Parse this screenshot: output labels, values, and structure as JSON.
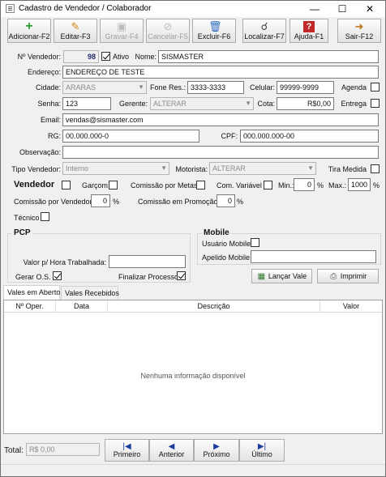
{
  "window": {
    "title": "Cadastro de Vendedor / Colaborador"
  },
  "toolbar": {
    "buttons": [
      {
        "label": "Adicionar-F2",
        "icon": "plus-icon",
        "enabled": true
      },
      {
        "label": "Editar-F3",
        "icon": "pencil-icon",
        "enabled": true
      },
      {
        "label": "Gravar-F4",
        "icon": "save-icon",
        "enabled": false
      },
      {
        "label": "Cancelar-F5",
        "icon": "cancel-icon",
        "enabled": false
      },
      {
        "label": "Excluir-F6",
        "icon": "trash-icon",
        "enabled": true
      },
      {
        "label": "Localizar-F7",
        "icon": "magnifier-icon",
        "enabled": true
      },
      {
        "label": "Ajuda-F1",
        "icon": "help-icon",
        "enabled": true
      },
      {
        "label": "Sair-F12",
        "icon": "exit-icon",
        "enabled": true
      }
    ]
  },
  "form": {
    "vendedor_label": "Nº Vendedor:",
    "vendedor_value": "98",
    "ativo_label": "Ativo",
    "nome_label": "Nome:",
    "nome_value": "SISMASTER",
    "endereco_label": "Endereço:",
    "endereco_value": "ENDEREÇO DE TESTE",
    "cidade_label": "Cidade:",
    "cidade_value": "ARARAS",
    "fone_label": "Fone Res.:",
    "fone_value": "3333-3333",
    "celular_label": "Celular:",
    "celular_value": "99999-9999",
    "agenda_label": "Agenda",
    "senha_label": "Senha:",
    "senha_value": "123",
    "gerente_label": "Gerente:",
    "gerente_value": "ALTERAR",
    "cota_label": "Cota:",
    "cota_value": "R$0,00",
    "entrega_label": "Entrega",
    "email_label": "Email:",
    "email_value": "vendas@sismaster.com",
    "rg_label": "RG:",
    "rg_value": "00.000.000-0",
    "cpf_label": "CPF:",
    "cpf_value": "000.000.000-00",
    "observacao_label": "Observação:",
    "observacao_value": "",
    "tipo_label": "Tipo Vendedor:",
    "tipo_value": "Interno",
    "motorista_label": "Motorista:",
    "motorista_value": "ALTERAR",
    "tira_medida_label": "Tira Medida",
    "vendedor_chk_label": "Vendedor",
    "garcom_label": "Garçom",
    "comissao_metas_label": "Comissão por Metas",
    "com_variavel_label": "Com. Variável",
    "min_label": "Min.:",
    "min_value": "0",
    "min_unit": "%",
    "max_label": "Max.:",
    "max_value": "1000",
    "max_unit": "%",
    "comissao_vendedor_label": "Comissão por Vendedor:",
    "comissao_vendedor_value": "0",
    "comissao_vendedor_unit": "%",
    "comissao_promocao_label": "Comissão em Promoção:",
    "comissao_promocao_value": "0",
    "comissao_promocao_unit": "%",
    "tecnico_label": "Técnico"
  },
  "pcp": {
    "title": "PCP",
    "valor_hora_label": "Valor p/ Hora Trabalhada:",
    "valor_hora_value": "",
    "gerar_os_label": "Gerar O.S.",
    "finalizar_label": "Finalizar Processo"
  },
  "mobile": {
    "title": "Mobile",
    "usuario_label": "Usuário Mobile",
    "apelido_label": "Apelido Mobile:",
    "apelido_value": ""
  },
  "actions": {
    "lancar_vale": "Lançar Vale",
    "imprimir": "Imprimir"
  },
  "tabs": [
    {
      "label": "Vales em Aberto",
      "active": true
    },
    {
      "label": "Vales Recebidos",
      "active": false
    }
  ],
  "grid": {
    "columns": [
      "Nº Oper.",
      "Data",
      "Descrição",
      "Valor"
    ],
    "empty_text": "Nenhuma informação disponível"
  },
  "footer": {
    "total_label": "Total:",
    "total_value": "R$ 0,00",
    "nav": [
      {
        "label": "Primeiro",
        "icon": "first-icon"
      },
      {
        "label": "Anterior",
        "icon": "prev-icon"
      },
      {
        "label": "Próximo",
        "icon": "next-icon"
      },
      {
        "label": "Último",
        "icon": "last-icon"
      }
    ]
  },
  "colors": {
    "accent_navy": "#1e2a6e",
    "nav_icon": "#1e3c9e"
  }
}
